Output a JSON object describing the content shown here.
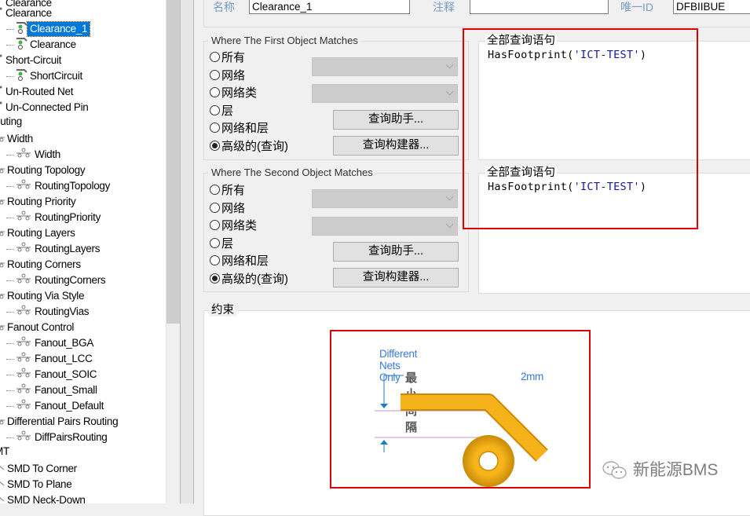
{
  "tree": {
    "top_partial_label": "Clearance",
    "items": [
      {
        "label": "Clearance",
        "level": 1,
        "kind": "category-electrical"
      },
      {
        "label": "Clearance_1",
        "level": 2,
        "kind": "rule-electrical",
        "selected": true
      },
      {
        "label": "Clearance",
        "level": 2,
        "kind": "rule-electrical"
      },
      {
        "label": "Short-Circuit",
        "level": 1,
        "kind": "category-electrical"
      },
      {
        "label": "ShortCircuit",
        "level": 2,
        "kind": "rule-electrical"
      },
      {
        "label": "Un-Routed Net",
        "level": 1,
        "kind": "category-electrical"
      },
      {
        "label": "Un-Connected Pin",
        "level": 1,
        "kind": "category-electrical"
      },
      {
        "label": "outing",
        "level": 0,
        "kind": "root"
      },
      {
        "label": "Width",
        "level": 1,
        "kind": "category-routing"
      },
      {
        "label": "Width",
        "level": 2,
        "kind": "rule-routing"
      },
      {
        "label": "Routing Topology",
        "level": 1,
        "kind": "category-routing"
      },
      {
        "label": "RoutingTopology",
        "level": 2,
        "kind": "rule-routing"
      },
      {
        "label": "Routing Priority",
        "level": 1,
        "kind": "category-routing"
      },
      {
        "label": "RoutingPriority",
        "level": 2,
        "kind": "rule-routing"
      },
      {
        "label": "Routing Layers",
        "level": 1,
        "kind": "category-routing"
      },
      {
        "label": "RoutingLayers",
        "level": 2,
        "kind": "rule-routing"
      },
      {
        "label": "Routing Corners",
        "level": 1,
        "kind": "category-routing"
      },
      {
        "label": "RoutingCorners",
        "level": 2,
        "kind": "rule-routing"
      },
      {
        "label": "Routing Via Style",
        "level": 1,
        "kind": "category-routing"
      },
      {
        "label": "RoutingVias",
        "level": 2,
        "kind": "rule-routing"
      },
      {
        "label": "Fanout Control",
        "level": 1,
        "kind": "category-routing"
      },
      {
        "label": "Fanout_BGA",
        "level": 2,
        "kind": "rule-routing"
      },
      {
        "label": "Fanout_LCC",
        "level": 2,
        "kind": "rule-routing"
      },
      {
        "label": "Fanout_SOIC",
        "level": 2,
        "kind": "rule-routing"
      },
      {
        "label": "Fanout_Small",
        "level": 2,
        "kind": "rule-routing"
      },
      {
        "label": "Fanout_Default",
        "level": 2,
        "kind": "rule-routing"
      },
      {
        "label": "Differential Pairs Routing",
        "level": 1,
        "kind": "category-routing"
      },
      {
        "label": "DiffPairsRouting",
        "level": 2,
        "kind": "rule-routing"
      },
      {
        "label": "MT",
        "level": 0,
        "kind": "root"
      },
      {
        "label": "SMD To Corner",
        "level": 1,
        "kind": "category-smt"
      },
      {
        "label": "SMD To Plane",
        "level": 1,
        "kind": "category-smt"
      },
      {
        "label": "SMD Neck-Down",
        "level": 1,
        "kind": "category-smt"
      }
    ]
  },
  "header": {
    "name_label": "名称",
    "name_value": "Clearance_1",
    "comment_label": "注释",
    "comment_value": "",
    "uid_label": "唯一ID",
    "uid_value": "DFBIIBUE"
  },
  "first_match": {
    "title": "Where The First Object Matches",
    "options": [
      "所有",
      "网络",
      "网络类",
      "层",
      "网络和层",
      "高级的(查询)"
    ],
    "selected_index": 5,
    "query_helper_button": "查询助手...",
    "query_builder_button": "查询构建器...",
    "full_query_title": "全部查询语句",
    "query_func": "HasFootprint(",
    "query_arg": "'ICT-TEST'",
    "query_close": ")"
  },
  "second_match": {
    "title": "Where The Second Object Matches",
    "options": [
      "所有",
      "网络",
      "网络类",
      "层",
      "网络和层",
      "高级的(查询)"
    ],
    "selected_index": 5,
    "query_helper_button": "查询助手...",
    "query_builder_button": "查询构建器...",
    "full_query_title": "全部查询语句",
    "query_func": "HasFootprint(",
    "query_arg": "'ICT-TEST'",
    "query_close": ")"
  },
  "constraints": {
    "title": "约束",
    "mode_label": "Different Nets Only",
    "min_clearance_label": "最小间隔",
    "min_clearance_value": "2mm"
  },
  "watermark": {
    "text": "新能源BMS",
    "icon": "wechat-icon"
  },
  "colors": {
    "selection": "#0078d7",
    "highlight_box": "#e00000",
    "track_copper": "#f5b21b",
    "dimension_blue": "#1f7fc0",
    "hint_text": "#3a78d6"
  }
}
